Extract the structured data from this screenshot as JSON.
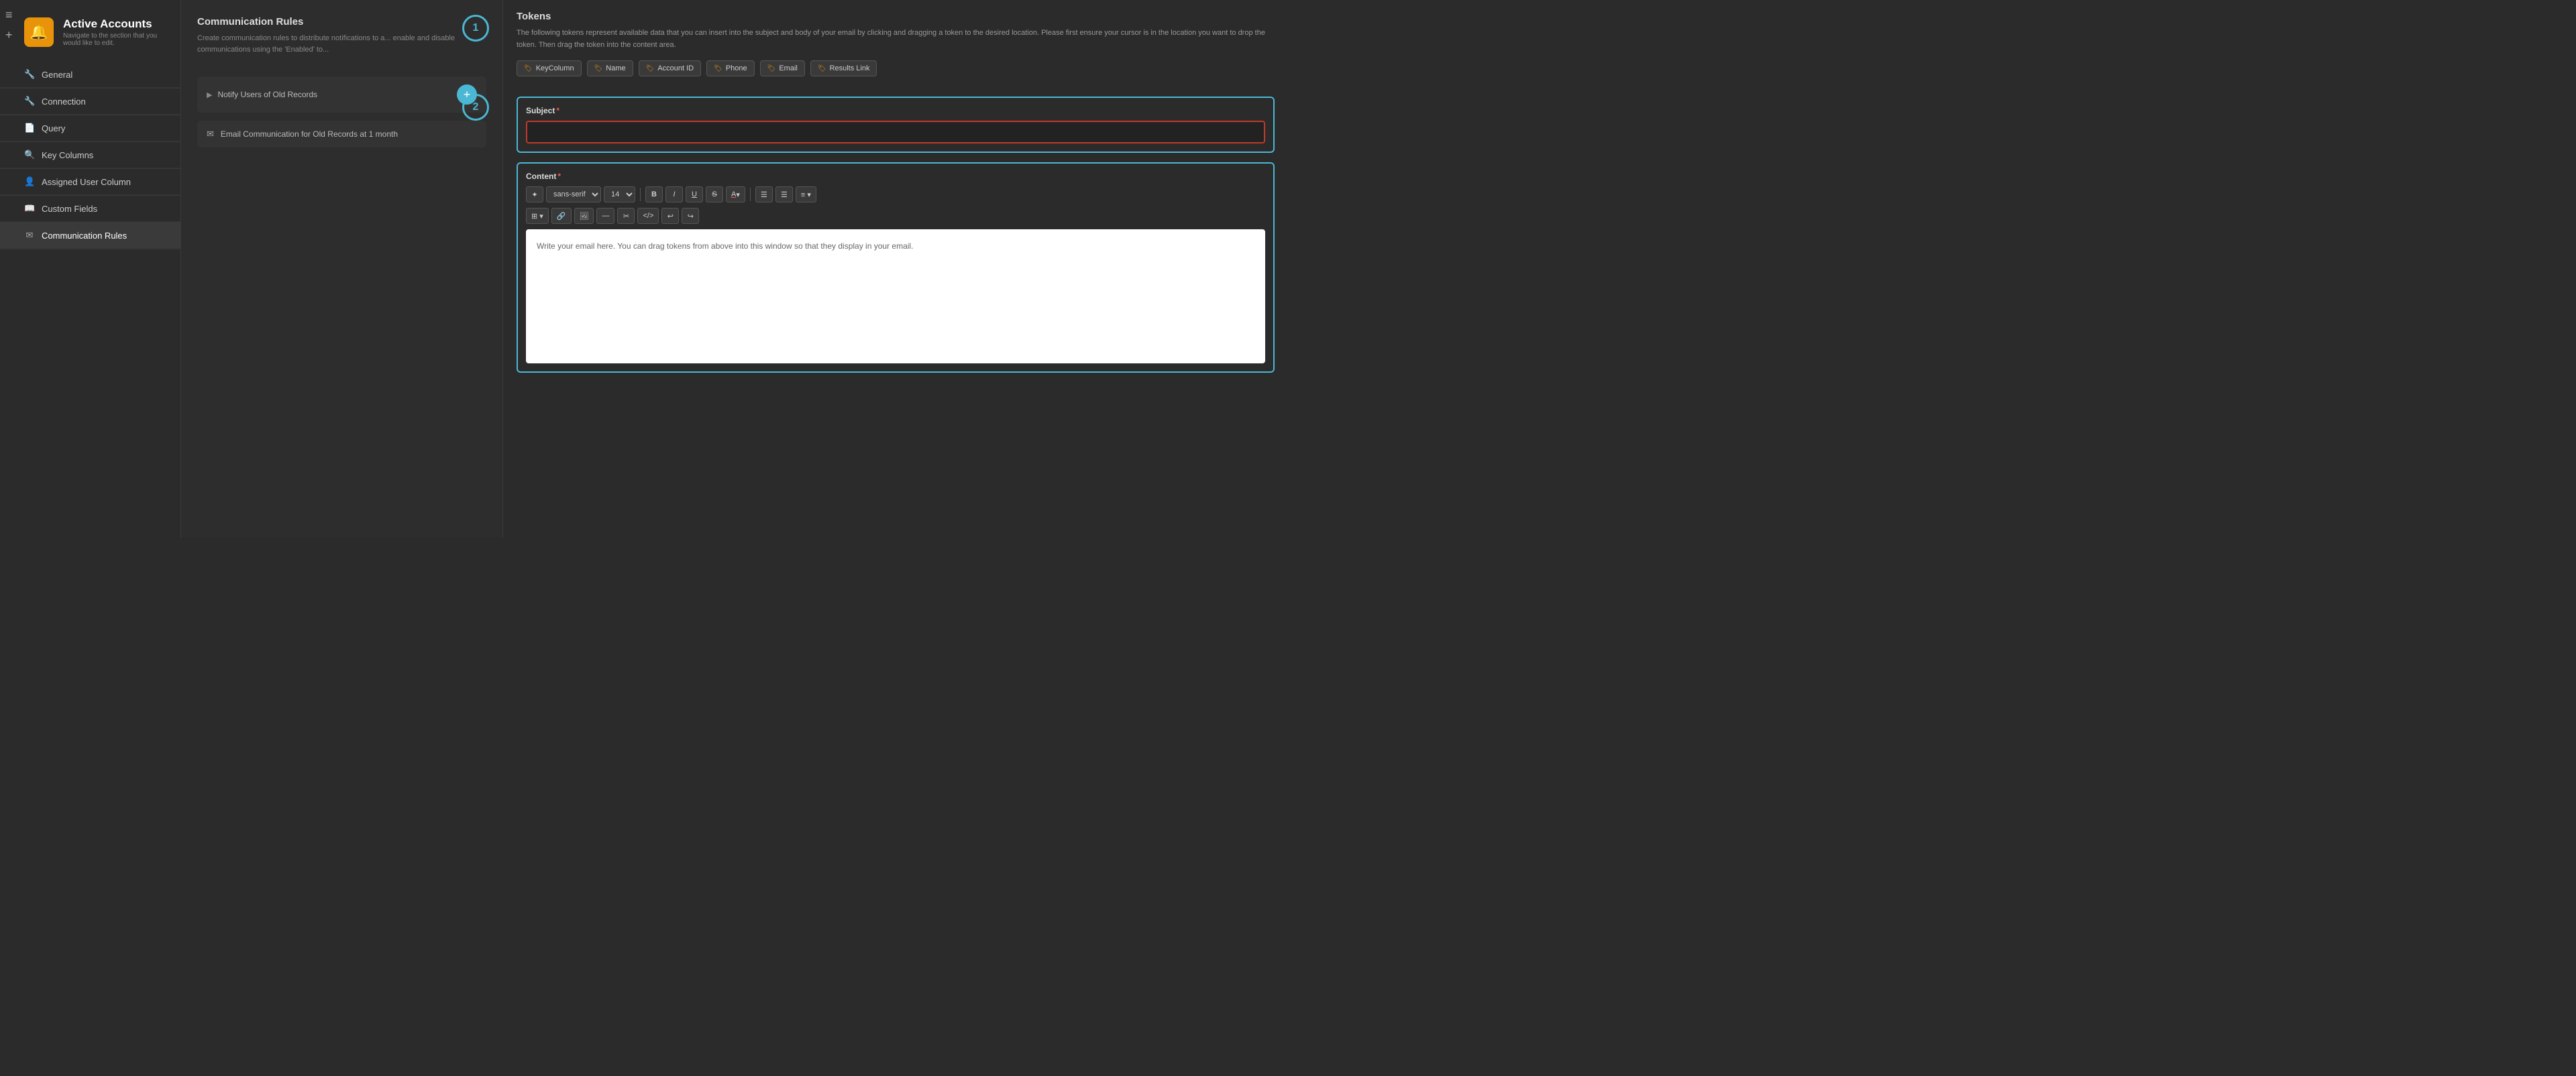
{
  "sidebar": {
    "toggle_icon": "≡",
    "add_icon": "+",
    "title": "Active Accounts",
    "subtitle": "Navigate to the section that you would like to edit.",
    "nav_items": [
      {
        "id": "general",
        "icon": "🔧",
        "label": "General",
        "active": false
      },
      {
        "id": "connection",
        "icon": "🔧",
        "label": "Connection",
        "active": false
      },
      {
        "id": "query",
        "icon": "📄",
        "label": "Query",
        "active": false
      },
      {
        "id": "key-columns",
        "icon": "🔍",
        "label": "Key Columns",
        "active": false
      },
      {
        "id": "assigned-user-column",
        "icon": "👤",
        "label": "Assigned User Column",
        "active": false
      },
      {
        "id": "custom-fields",
        "icon": "📖",
        "label": "Custom Fields",
        "active": false
      },
      {
        "id": "communication-rules",
        "icon": "✉",
        "label": "Communication Rules",
        "active": true
      }
    ]
  },
  "middle_panel": {
    "title": "Communication Rules",
    "description": "Create communication rules to distribute notifications to a... enable and disable communications using the 'Enabled' to...",
    "step1": "1",
    "step2": "2",
    "notify_label": "Notify Users of Old Records",
    "add_btn": "+",
    "email_label": "Email Communication for Old Records at 1 month"
  },
  "right_panel": {
    "tokens_title": "Tokens",
    "tokens_description": "The following tokens represent available data that you can insert into the subject and body of your email by clicking and dragging a token to the desired location. Please first ensure your cursor is in the location you want to drop the token. Then drag the token into the content area.",
    "token_pills": [
      {
        "id": "key-column",
        "label": "KeyColumn"
      },
      {
        "id": "name",
        "label": "Name"
      },
      {
        "id": "account-id",
        "label": "Account ID"
      },
      {
        "id": "phone",
        "label": "Phone"
      },
      {
        "id": "email",
        "label": "Email"
      },
      {
        "id": "results-link",
        "label": "Results Link"
      }
    ],
    "subject_label": "Subject",
    "subject_required": "*",
    "subject_placeholder": "",
    "content_label": "Content",
    "content_required": "*",
    "toolbar_row1": {
      "magic_btn": "✦",
      "font_select": "sans-serif",
      "size_select": "14",
      "bold": "B",
      "italic": "I",
      "underline": "U",
      "strikethrough": "S",
      "font_color": "A",
      "list_unordered": "≡",
      "list_ordered": "≡",
      "align": "≡"
    },
    "toolbar_row2": {
      "table": "⊞",
      "link": "🔗",
      "image": "🖼",
      "hr": "—",
      "scissors": "✂",
      "code": "</>",
      "undo": "↩",
      "redo": "↪"
    },
    "editor_placeholder": "Write your email here. You can drag tokens from above into this window so that they display in your email."
  }
}
